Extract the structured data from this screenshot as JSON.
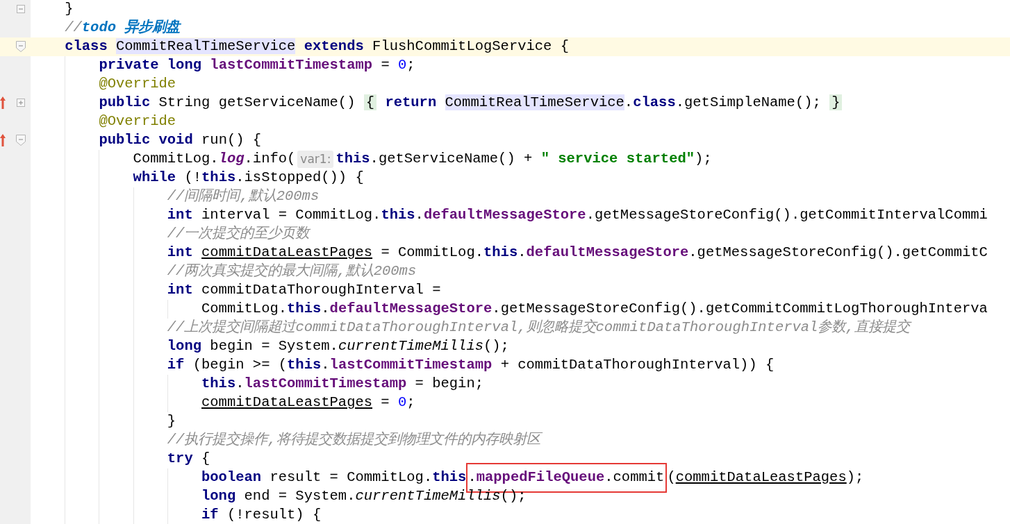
{
  "editor": {
    "lines": [
      {
        "current": false,
        "override": false,
        "fold_marker": {
          "kind": "end"
        },
        "tokens": [
          {
            "kind": "plain",
            "text": "}"
          }
        ]
      },
      {
        "current": false,
        "override": false,
        "tokens": [
          {
            "kind": "comment",
            "text": "//"
          },
          {
            "kind": "todo",
            "text": "todo 异步刷盘"
          }
        ]
      },
      {
        "current": true,
        "override": false,
        "fold_marker": {
          "kind": "start"
        },
        "tokens": [
          {
            "kind": "kw",
            "text": "class "
          },
          {
            "kind": "ref",
            "text": "CommitRealTimeService"
          },
          {
            "kind": "kw",
            "text": " extends"
          },
          {
            "kind": "plain",
            "text": " FlushCommitLogService {"
          }
        ],
        "children": [
          {
            "current": false,
            "override": false,
            "tokens": [
              {
                "kind": "kw",
                "text": "private long "
              },
              {
                "kind": "field",
                "text": "lastCommitTimestamp"
              },
              {
                "kind": "plain",
                "text": " = "
              },
              {
                "kind": "num",
                "text": "0"
              },
              {
                "kind": "plain",
                "text": ";"
              }
            ]
          },
          {
            "current": false,
            "override": false,
            "tokens": [
              {
                "kind": "anno",
                "text": "@Override"
              }
            ]
          },
          {
            "current": false,
            "override": true,
            "fold_marker": {
              "kind": "collapsed"
            },
            "tokens": [
              {
                "kind": "kw",
                "text": "public"
              },
              {
                "kind": "plain",
                "text": " String getServiceName() "
              },
              {
                "kind": "brace",
                "text": "{"
              },
              {
                "kind": "kw",
                "text": " return "
              },
              {
                "kind": "ref",
                "text": "CommitRealTimeService"
              },
              {
                "kind": "plain",
                "text": "."
              },
              {
                "kind": "kw",
                "text": "class"
              },
              {
                "kind": "plain",
                "text": ".getSimpleName(); "
              },
              {
                "kind": "brace",
                "text": "}"
              }
            ]
          },
          {
            "current": false,
            "override": false,
            "tokens": [
              {
                "kind": "anno",
                "text": "@Override"
              }
            ]
          },
          {
            "current": false,
            "override": true,
            "fold_marker": {
              "kind": "start"
            },
            "tokens": [
              {
                "kind": "kw",
                "text": "public void"
              },
              {
                "kind": "plain",
                "text": " run() {"
              }
            ],
            "children": [
              {
                "current": false,
                "override": false,
                "tokens": [
                  {
                    "kind": "plain",
                    "text": "CommitLog."
                  },
                  {
                    "kind": "static",
                    "text": "log"
                  },
                  {
                    "kind": "plain",
                    "text": ".info("
                  },
                  {
                    "kind": "hint",
                    "text": "var1:"
                  },
                  {
                    "kind": "kw",
                    "text": "this"
                  },
                  {
                    "kind": "plain",
                    "text": ".getServiceName() + "
                  },
                  {
                    "kind": "str",
                    "text": "\" service started\""
                  },
                  {
                    "kind": "plain",
                    "text": ");"
                  }
                ]
              },
              {
                "current": false,
                "override": false,
                "tokens": [
                  {
                    "kind": "kw",
                    "text": "while"
                  },
                  {
                    "kind": "plain",
                    "text": " (!"
                  },
                  {
                    "kind": "kw",
                    "text": "this"
                  },
                  {
                    "kind": "plain",
                    "text": ".isStopped()) {"
                  }
                ],
                "children": [
                  {
                    "current": false,
                    "override": false,
                    "tokens": [
                      {
                        "kind": "comment",
                        "text": "//间隔时间,默认200ms"
                      }
                    ]
                  },
                  {
                    "current": false,
                    "override": false,
                    "tokens": [
                      {
                        "kind": "kw",
                        "text": "int"
                      },
                      {
                        "kind": "plain",
                        "text": " interval = CommitLog."
                      },
                      {
                        "kind": "kw",
                        "text": "this"
                      },
                      {
                        "kind": "plain",
                        "text": "."
                      },
                      {
                        "kind": "field",
                        "text": "defaultMessageStore"
                      },
                      {
                        "kind": "plain",
                        "text": ".getMessageStoreConfig().getCommitIntervalCommi"
                      }
                    ]
                  },
                  {
                    "current": false,
                    "override": false,
                    "tokens": [
                      {
                        "kind": "comment",
                        "text": "//一次提交的至少页数"
                      }
                    ]
                  },
                  {
                    "current": false,
                    "override": false,
                    "tokens": [
                      {
                        "kind": "kw",
                        "text": "int "
                      },
                      {
                        "kind": "under",
                        "text": "commitDataLeastPages"
                      },
                      {
                        "kind": "plain",
                        "text": " = CommitLog."
                      },
                      {
                        "kind": "kw",
                        "text": "this"
                      },
                      {
                        "kind": "plain",
                        "text": "."
                      },
                      {
                        "kind": "field",
                        "text": "defaultMessageStore"
                      },
                      {
                        "kind": "plain",
                        "text": ".getMessageStoreConfig().getCommitC"
                      }
                    ]
                  },
                  {
                    "current": false,
                    "override": false,
                    "tokens": [
                      {
                        "kind": "comment",
                        "text": "//两次真实提交的最大间隔,默认200ms"
                      }
                    ]
                  },
                  {
                    "current": false,
                    "override": false,
                    "tokens": [
                      {
                        "kind": "kw",
                        "text": "int"
                      },
                      {
                        "kind": "plain",
                        "text": " commitDataThoroughInterval ="
                      }
                    ],
                    "children": [
                      {
                        "current": false,
                        "override": false,
                        "tokens": [
                          {
                            "kind": "plain",
                            "text": "CommitLog."
                          },
                          {
                            "kind": "kw",
                            "text": "this"
                          },
                          {
                            "kind": "plain",
                            "text": "."
                          },
                          {
                            "kind": "field",
                            "text": "defaultMessageStore"
                          },
                          {
                            "kind": "plain",
                            "text": ".getMessageStoreConfig().getCommitCommitLogThoroughInterva"
                          }
                        ]
                      }
                    ]
                  },
                  {
                    "current": false,
                    "override": false,
                    "tokens": [
                      {
                        "kind": "comment",
                        "text": "//上次提交间隔超过commitDataThoroughInterval,则忽略提交commitDataThoroughInterval参数,直接提交"
                      }
                    ]
                  },
                  {
                    "current": false,
                    "override": false,
                    "tokens": [
                      {
                        "kind": "kw",
                        "text": "long"
                      },
                      {
                        "kind": "plain",
                        "text": " begin = System."
                      },
                      {
                        "kind": "italic",
                        "text": "currentTimeMillis"
                      },
                      {
                        "kind": "plain",
                        "text": "();"
                      }
                    ]
                  },
                  {
                    "current": false,
                    "override": false,
                    "tokens": [
                      {
                        "kind": "kw",
                        "text": "if"
                      },
                      {
                        "kind": "plain",
                        "text": " (begin >= ("
                      },
                      {
                        "kind": "kw",
                        "text": "this"
                      },
                      {
                        "kind": "plain",
                        "text": "."
                      },
                      {
                        "kind": "field",
                        "text": "lastCommitTimestamp"
                      },
                      {
                        "kind": "plain",
                        "text": " + commitDataThoroughInterval)) {"
                      }
                    ],
                    "children": [
                      {
                        "current": false,
                        "override": false,
                        "tokens": [
                          {
                            "kind": "kw",
                            "text": "this"
                          },
                          {
                            "kind": "plain",
                            "text": "."
                          },
                          {
                            "kind": "field",
                            "text": "lastCommitTimestamp"
                          },
                          {
                            "kind": "plain",
                            "text": " = begin;"
                          }
                        ]
                      },
                      {
                        "current": false,
                        "override": false,
                        "tokens": [
                          {
                            "kind": "under",
                            "text": "commitDataLeastPages"
                          },
                          {
                            "kind": "plain",
                            "text": " = "
                          },
                          {
                            "kind": "num",
                            "text": "0"
                          },
                          {
                            "kind": "plain",
                            "text": ";"
                          }
                        ]
                      }
                    ]
                  },
                  {
                    "current": false,
                    "override": false,
                    "tokens": [
                      {
                        "kind": "plain",
                        "text": "}"
                      }
                    ]
                  },
                  {
                    "current": false,
                    "override": false,
                    "tokens": [
                      {
                        "kind": "comment",
                        "text": "//执行提交操作,将待提交数据提交到物理文件的内存映射区"
                      }
                    ]
                  },
                  {
                    "current": false,
                    "override": false,
                    "tokens": [
                      {
                        "kind": "kw",
                        "text": "try"
                      },
                      {
                        "kind": "plain",
                        "text": " {"
                      }
                    ],
                    "children": [
                      {
                        "current": false,
                        "override": false,
                        "tokens": [
                          {
                            "kind": "kw",
                            "text": "boolean"
                          },
                          {
                            "kind": "plain",
                            "text": " result = CommitLog."
                          },
                          {
                            "kind": "kw",
                            "text": "this"
                          },
                          {
                            "kind": "box",
                            "children": [
                              {
                                "kind": "plain",
                                "text": "."
                              },
                              {
                                "kind": "field",
                                "text": "mappedFileQueue"
                              },
                              {
                                "kind": "plain",
                                "text": ".commit"
                              }
                            ]
                          },
                          {
                            "kind": "plain",
                            "text": "("
                          },
                          {
                            "kind": "under",
                            "text": "commitDataLeastPages"
                          },
                          {
                            "kind": "plain",
                            "text": ");"
                          }
                        ]
                      },
                      {
                        "current": false,
                        "override": false,
                        "tokens": [
                          {
                            "kind": "kw",
                            "text": "long"
                          },
                          {
                            "kind": "plain",
                            "text": " end = System."
                          },
                          {
                            "kind": "italic",
                            "text": "currentTimeMillis"
                          },
                          {
                            "kind": "plain",
                            "text": "();"
                          }
                        ]
                      },
                      {
                        "current": false,
                        "override": false,
                        "tokens": [
                          {
                            "kind": "kw",
                            "text": "if"
                          },
                          {
                            "kind": "plain",
                            "text": " (!result) {"
                          }
                        ]
                      }
                    ]
                  }
                ]
              }
            ]
          }
        ]
      }
    ]
  }
}
